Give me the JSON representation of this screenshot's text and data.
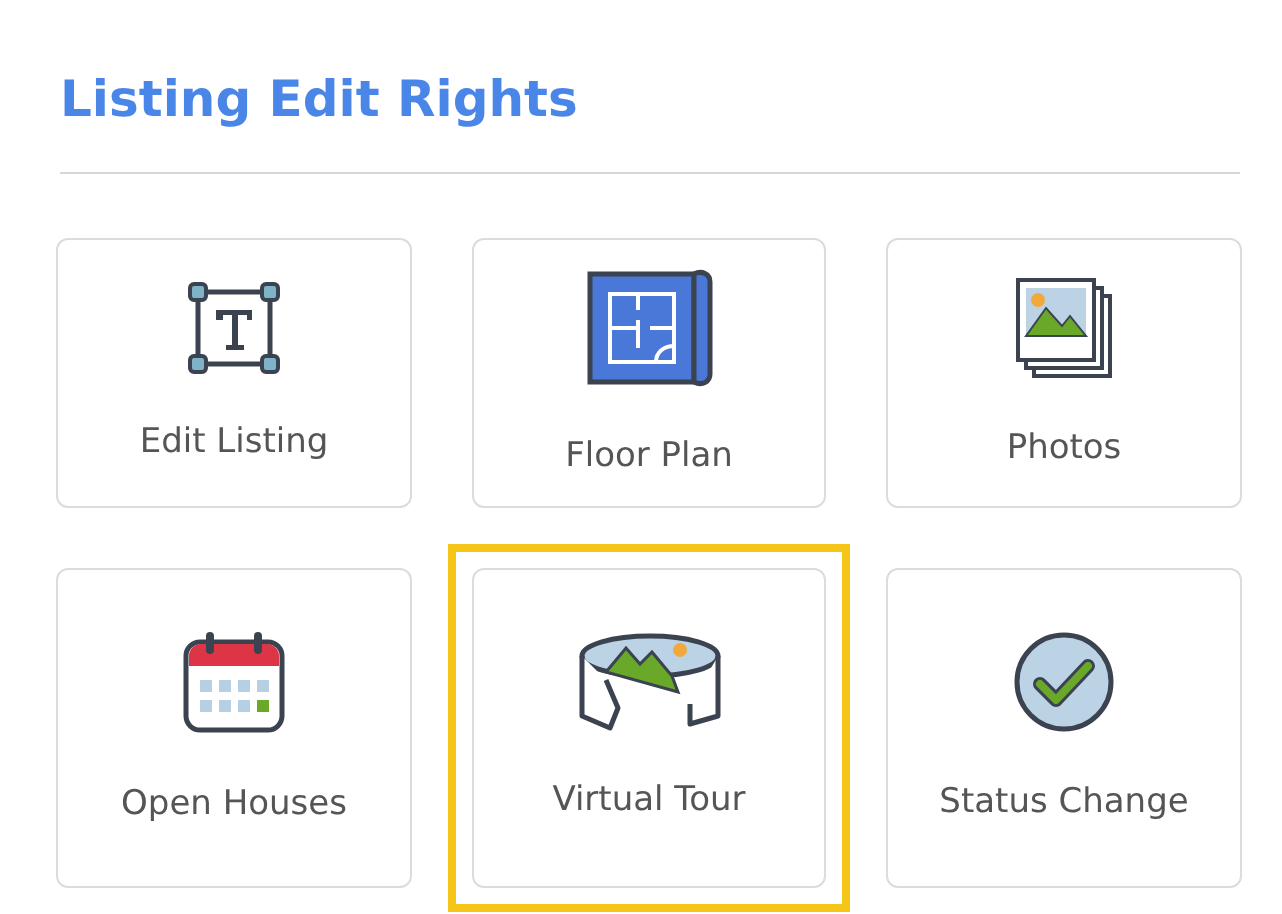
{
  "title": "Listing Edit Rights",
  "items": [
    {
      "kind": "text-frame",
      "label": "Edit Listing",
      "selected": false
    },
    {
      "kind": "floor-plan",
      "label": "Floor Plan",
      "selected": false
    },
    {
      "kind": "photos",
      "label": "Photos",
      "selected": false
    },
    {
      "kind": "calendar",
      "label": "Open Houses",
      "selected": false
    },
    {
      "kind": "panorama",
      "label": "Virtual Tour",
      "selected": true
    },
    {
      "kind": "check",
      "label": "Status Change",
      "selected": false
    }
  ]
}
